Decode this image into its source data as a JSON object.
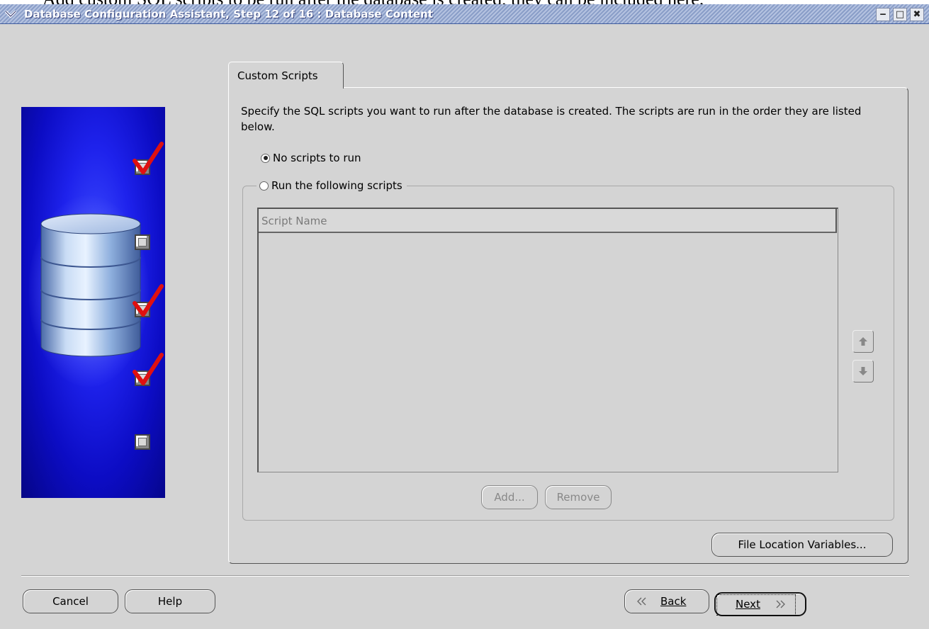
{
  "document_text": "Add custom SQL scripts to be run after the database is created, they can be included here.",
  "window": {
    "title": "Database Configuration Assistant, Step 12 of 16 : Database Content",
    "controls": {
      "minimize": "‒",
      "maximize": "□",
      "close": "✖"
    }
  },
  "steps": {
    "states": [
      "checked",
      "unchecked",
      "checked",
      "checked",
      "unchecked"
    ]
  },
  "tab": {
    "label": "Custom Scripts"
  },
  "content": {
    "description": "Specify the SQL scripts you want to run after the database is created. The scripts are run in the order they are listed below.",
    "radio_no_scripts": {
      "label": "No scripts to run",
      "selected": true
    },
    "radio_run_scripts": {
      "label": "Run the following scripts",
      "selected": false
    },
    "table": {
      "column_header": "Script Name",
      "rows": []
    },
    "add_label": "Add...",
    "remove_label": "Remove",
    "file_location_label": "File Location Variables..."
  },
  "footer": {
    "cancel_label": "Cancel",
    "help_label": "Help",
    "back_label": "Back",
    "next_label": "Next"
  },
  "colors": {
    "panel_blue": "#1e22ec",
    "check_red": "#e01010",
    "window_bg": "#d4d4d4"
  }
}
